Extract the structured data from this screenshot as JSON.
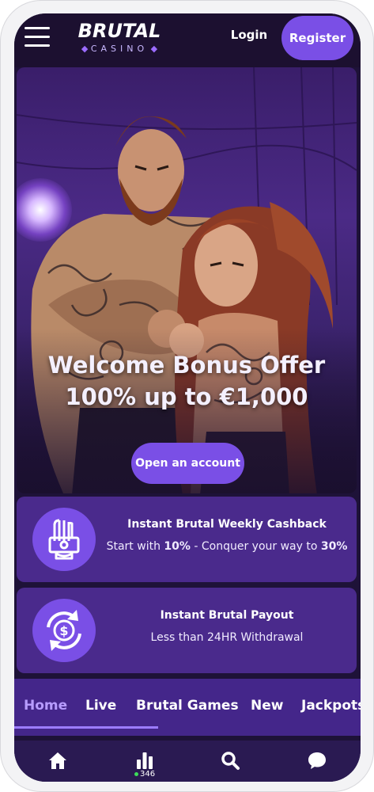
{
  "header": {
    "logo_main": "BRUTAL",
    "logo_sub": "CASINO",
    "login_label": "Login",
    "register_label": "Register"
  },
  "hero": {
    "title_line1": "Welcome Bonus Offer",
    "title_line2": "100% up to €1,000",
    "cta_label": "Open an account"
  },
  "promos": [
    {
      "title": "Instant Brutal Weekly Cashback",
      "text_prefix": "Start with ",
      "text_bold1": "10%",
      "text_mid": " - Conquer your way to ",
      "text_bold2": "30%",
      "icon": "cashback-hand-icon"
    },
    {
      "title": "Instant Brutal Payout",
      "text": "Less than 24HR Withdrawal",
      "icon": "dollar-refresh-icon"
    }
  ],
  "tabs": [
    {
      "label": "Home",
      "active": true
    },
    {
      "label": "Live",
      "active": false
    },
    {
      "label": "Brutal Games",
      "active": false
    },
    {
      "label": "New",
      "active": false
    },
    {
      "label": "Jackpots",
      "active": false
    }
  ],
  "bottom_bar": {
    "items": [
      "home-icon",
      "stats-icon",
      "search-icon",
      "chat-icon"
    ],
    "live_count": "346"
  },
  "colors": {
    "accent": "#7a4fe6",
    "header_bg": "#1c1030",
    "card_bg": "#4a2a8c",
    "tab_active": "#b79cff",
    "live_dot": "#3ddc5a"
  }
}
